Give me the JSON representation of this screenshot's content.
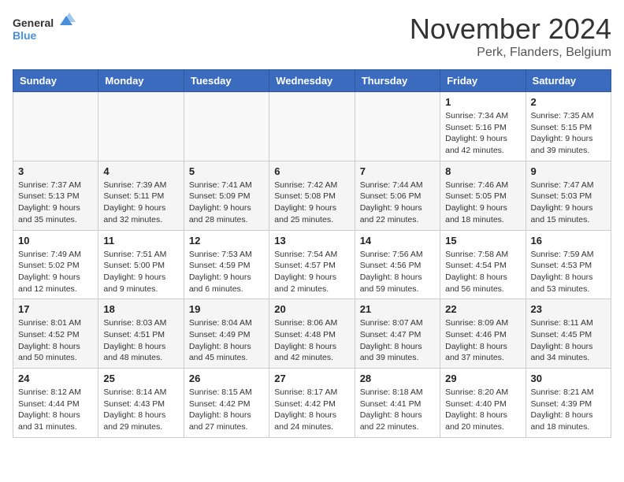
{
  "logo": {
    "line1": "General",
    "line2": "Blue"
  },
  "title": "November 2024",
  "location": "Perk, Flanders, Belgium",
  "headers": [
    "Sunday",
    "Monday",
    "Tuesday",
    "Wednesday",
    "Thursday",
    "Friday",
    "Saturday"
  ],
  "weeks": [
    [
      {
        "day": "",
        "info": ""
      },
      {
        "day": "",
        "info": ""
      },
      {
        "day": "",
        "info": ""
      },
      {
        "day": "",
        "info": ""
      },
      {
        "day": "",
        "info": ""
      },
      {
        "day": "1",
        "info": "Sunrise: 7:34 AM\nSunset: 5:16 PM\nDaylight: 9 hours\nand 42 minutes."
      },
      {
        "day": "2",
        "info": "Sunrise: 7:35 AM\nSunset: 5:15 PM\nDaylight: 9 hours\nand 39 minutes."
      }
    ],
    [
      {
        "day": "3",
        "info": "Sunrise: 7:37 AM\nSunset: 5:13 PM\nDaylight: 9 hours\nand 35 minutes."
      },
      {
        "day": "4",
        "info": "Sunrise: 7:39 AM\nSunset: 5:11 PM\nDaylight: 9 hours\nand 32 minutes."
      },
      {
        "day": "5",
        "info": "Sunrise: 7:41 AM\nSunset: 5:09 PM\nDaylight: 9 hours\nand 28 minutes."
      },
      {
        "day": "6",
        "info": "Sunrise: 7:42 AM\nSunset: 5:08 PM\nDaylight: 9 hours\nand 25 minutes."
      },
      {
        "day": "7",
        "info": "Sunrise: 7:44 AM\nSunset: 5:06 PM\nDaylight: 9 hours\nand 22 minutes."
      },
      {
        "day": "8",
        "info": "Sunrise: 7:46 AM\nSunset: 5:05 PM\nDaylight: 9 hours\nand 18 minutes."
      },
      {
        "day": "9",
        "info": "Sunrise: 7:47 AM\nSunset: 5:03 PM\nDaylight: 9 hours\nand 15 minutes."
      }
    ],
    [
      {
        "day": "10",
        "info": "Sunrise: 7:49 AM\nSunset: 5:02 PM\nDaylight: 9 hours\nand 12 minutes."
      },
      {
        "day": "11",
        "info": "Sunrise: 7:51 AM\nSunset: 5:00 PM\nDaylight: 9 hours\nand 9 minutes."
      },
      {
        "day": "12",
        "info": "Sunrise: 7:53 AM\nSunset: 4:59 PM\nDaylight: 9 hours\nand 6 minutes."
      },
      {
        "day": "13",
        "info": "Sunrise: 7:54 AM\nSunset: 4:57 PM\nDaylight: 9 hours\nand 2 minutes."
      },
      {
        "day": "14",
        "info": "Sunrise: 7:56 AM\nSunset: 4:56 PM\nDaylight: 8 hours\nand 59 minutes."
      },
      {
        "day": "15",
        "info": "Sunrise: 7:58 AM\nSunset: 4:54 PM\nDaylight: 8 hours\nand 56 minutes."
      },
      {
        "day": "16",
        "info": "Sunrise: 7:59 AM\nSunset: 4:53 PM\nDaylight: 8 hours\nand 53 minutes."
      }
    ],
    [
      {
        "day": "17",
        "info": "Sunrise: 8:01 AM\nSunset: 4:52 PM\nDaylight: 8 hours\nand 50 minutes."
      },
      {
        "day": "18",
        "info": "Sunrise: 8:03 AM\nSunset: 4:51 PM\nDaylight: 8 hours\nand 48 minutes."
      },
      {
        "day": "19",
        "info": "Sunrise: 8:04 AM\nSunset: 4:49 PM\nDaylight: 8 hours\nand 45 minutes."
      },
      {
        "day": "20",
        "info": "Sunrise: 8:06 AM\nSunset: 4:48 PM\nDaylight: 8 hours\nand 42 minutes."
      },
      {
        "day": "21",
        "info": "Sunrise: 8:07 AM\nSunset: 4:47 PM\nDaylight: 8 hours\nand 39 minutes."
      },
      {
        "day": "22",
        "info": "Sunrise: 8:09 AM\nSunset: 4:46 PM\nDaylight: 8 hours\nand 37 minutes."
      },
      {
        "day": "23",
        "info": "Sunrise: 8:11 AM\nSunset: 4:45 PM\nDaylight: 8 hours\nand 34 minutes."
      }
    ],
    [
      {
        "day": "24",
        "info": "Sunrise: 8:12 AM\nSunset: 4:44 PM\nDaylight: 8 hours\nand 31 minutes."
      },
      {
        "day": "25",
        "info": "Sunrise: 8:14 AM\nSunset: 4:43 PM\nDaylight: 8 hours\nand 29 minutes."
      },
      {
        "day": "26",
        "info": "Sunrise: 8:15 AM\nSunset: 4:42 PM\nDaylight: 8 hours\nand 27 minutes."
      },
      {
        "day": "27",
        "info": "Sunrise: 8:17 AM\nSunset: 4:42 PM\nDaylight: 8 hours\nand 24 minutes."
      },
      {
        "day": "28",
        "info": "Sunrise: 8:18 AM\nSunset: 4:41 PM\nDaylight: 8 hours\nand 22 minutes."
      },
      {
        "day": "29",
        "info": "Sunrise: 8:20 AM\nSunset: 4:40 PM\nDaylight: 8 hours\nand 20 minutes."
      },
      {
        "day": "30",
        "info": "Sunrise: 8:21 AM\nSunset: 4:39 PM\nDaylight: 8 hours\nand 18 minutes."
      }
    ]
  ]
}
